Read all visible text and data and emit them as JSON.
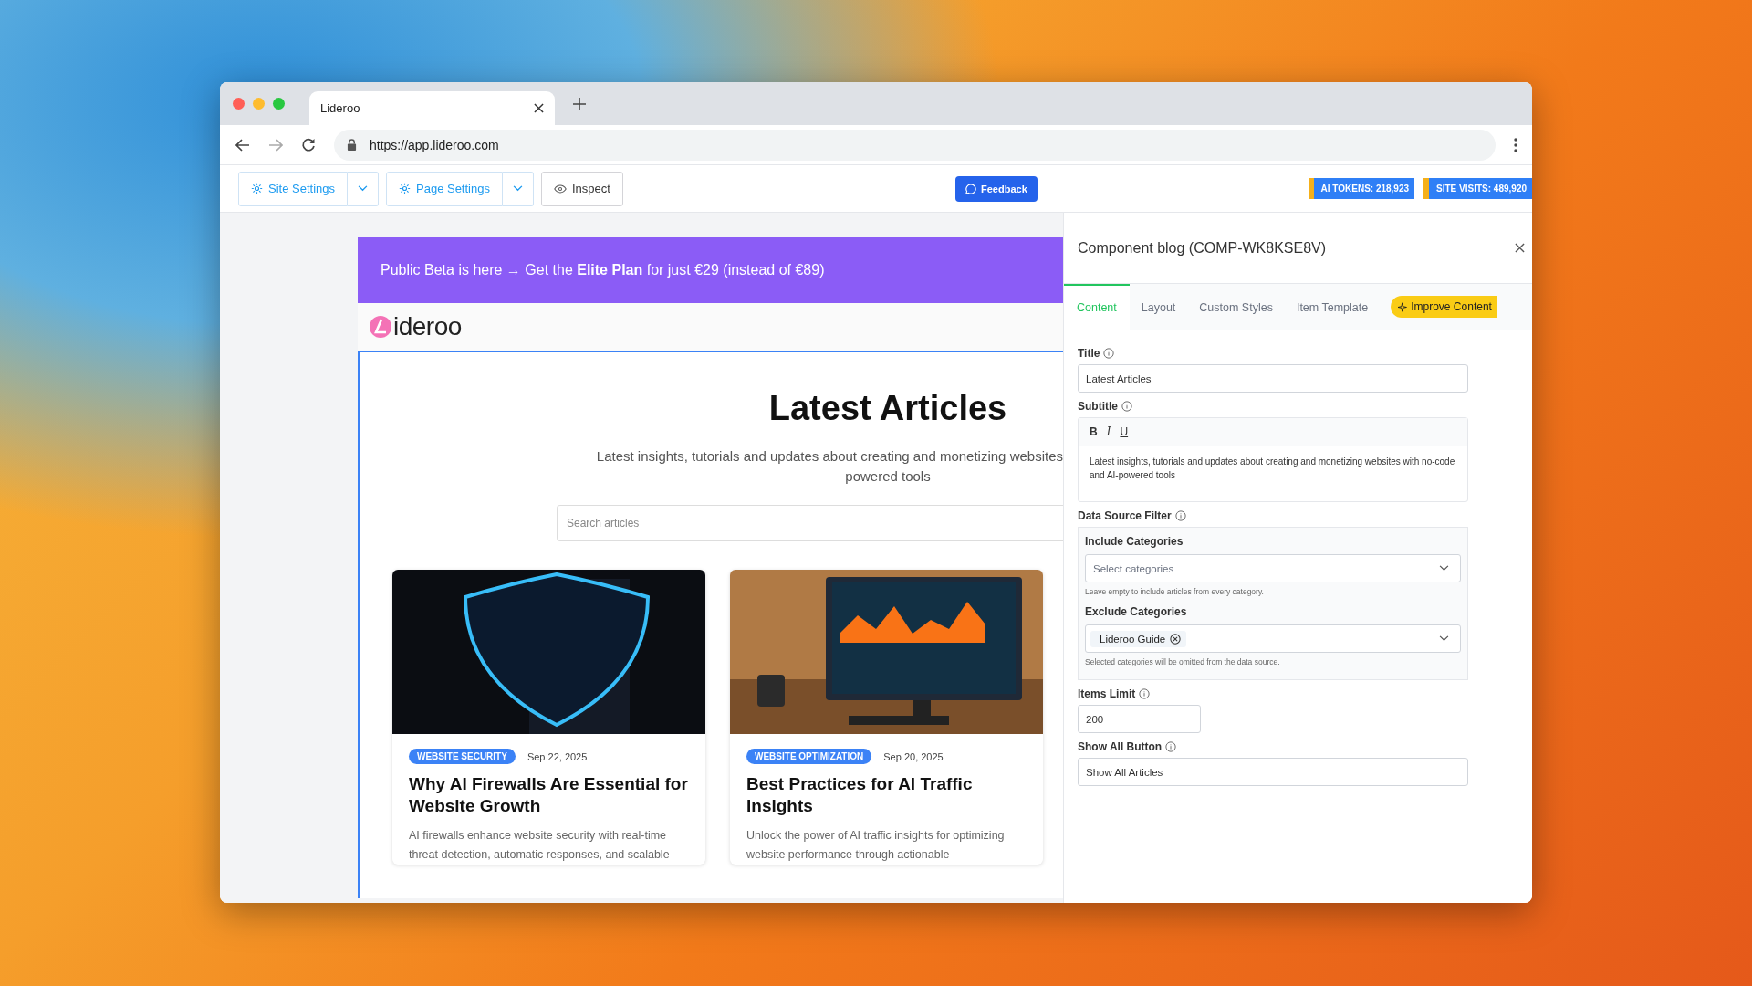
{
  "browser": {
    "tabs": [
      {
        "title": "Lideroo",
        "selected": true
      }
    ],
    "url": "https://app.lideroo.com"
  },
  "toolbar": {
    "buttons": [
      {
        "label": "Site Settings",
        "kind": "split"
      },
      {
        "label": "Page Settings",
        "kind": "split"
      },
      {
        "label": "Inspect",
        "kind": "plain"
      }
    ],
    "feedback": "Feedback",
    "badges": [
      "AI TOKENS: 218,923",
      "SITE VISITS: 489,920"
    ]
  },
  "preview": {
    "banner": "Public Beta is here → Get the **Elite Plan** for just €29 (instead of €89)",
    "logo": "ideroo",
    "title": "Latest Articles",
    "subtitle_lines": [
      "Latest insights, tutorials and updates about creating and monetizing websites",
      "powered tools"
    ],
    "search": {
      "placeholder": "Search articles"
    },
    "articles": [
      {
        "kind": "shield",
        "category": "WEBSITE SECURITY",
        "date": "Sep 22, 2025",
        "title": "Why AI Firewalls Are Essential for Website Growth",
        "excerpt": "AI firewalls enhance website security with real-time threat detection, automatic responses, and scalable"
      },
      {
        "kind": "monitor",
        "category": "WEBSITE OPTIMIZATION",
        "date": "Sep 20, 2025",
        "title": "Best Practices for AI Traffic Insights",
        "excerpt": "Unlock the power of AI traffic insights for optimizing website performance through actionable"
      }
    ]
  },
  "panel": {
    "title": "Component blog (COMP-WK8KSE8V)",
    "tabs": [
      {
        "label": "Content",
        "selected": true
      },
      {
        "label": "Layout",
        "selected": false
      },
      {
        "label": "Custom Styles",
        "selected": false
      },
      {
        "label": "Item Template",
        "selected": false
      }
    ],
    "improve_button": "Improve Content",
    "title_field": {
      "label": "Title",
      "value": "Latest Articles"
    },
    "subtitle_field": {
      "label": "Subtitle",
      "format_buttons": [
        {
          "label": "B",
          "kind": "bold"
        },
        {
          "label": "I",
          "kind": "italic"
        },
        {
          "label": "U",
          "kind": "underline"
        }
      ],
      "value": "Latest insights, tutorials and updates about creating and monetizing websites with no-code and AI-powered tools"
    },
    "data_source": {
      "label": "Data Source Filter",
      "include": {
        "label": "Include Categories",
        "placeholder": "Select categories",
        "hint": "Leave empty to include articles from every category."
      },
      "exclude": {
        "label": "Exclude Categories",
        "tags": [
          "Lideroo Guide"
        ],
        "hint": "Selected categories will be omitted from the data source."
      }
    },
    "items_limit": {
      "label": "Items Limit",
      "value": "200"
    },
    "show_all": {
      "label": "Show All Button",
      "value": "Show All Articles"
    }
  }
}
